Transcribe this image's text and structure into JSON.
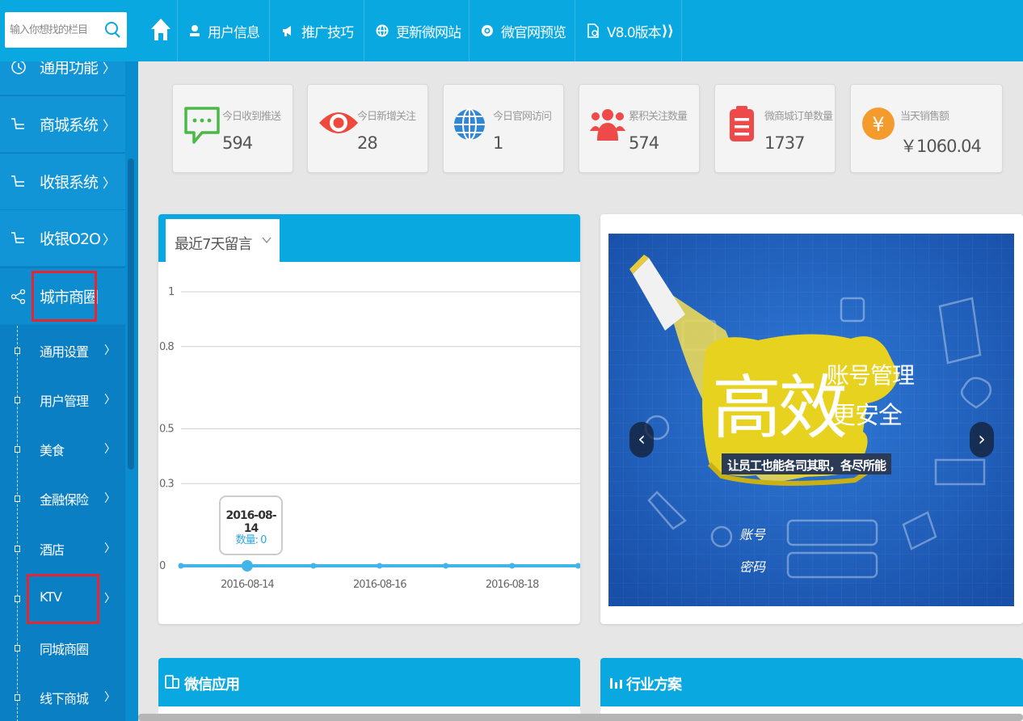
{
  "search": {
    "placeholder": "输入你想找的栏目"
  },
  "top_nav": [
    {
      "label": "用户信息",
      "icon": "user-icon"
    },
    {
      "label": "推广技巧",
      "icon": "megaphone-icon"
    },
    {
      "label": "更新微网站",
      "icon": "globe-icon"
    },
    {
      "label": "微官网预览",
      "icon": "eye-icon"
    },
    {
      "label": "V8.0版本",
      "icon": "version-icon"
    }
  ],
  "sidebar": {
    "main_items": [
      {
        "label": "通用功能",
        "icon": "function-icon"
      },
      {
        "label": "商城系统",
        "icon": "cart-icon"
      },
      {
        "label": "收银系统",
        "icon": "cart-icon"
      },
      {
        "label": "收银O2O",
        "icon": "cart-icon"
      },
      {
        "label": "城市商圈",
        "icon": "share-icon"
      }
    ],
    "sub_items": [
      {
        "label": "通用设置",
        "chevron": "〉"
      },
      {
        "label": "用户管理",
        "chevron": "〉"
      },
      {
        "label": "美食",
        "chevron": "〉"
      },
      {
        "label": "金融保险",
        "chevron": "〉"
      },
      {
        "label": "酒店",
        "chevron": "〉"
      },
      {
        "label": "KTV",
        "chevron": "〉"
      },
      {
        "label": "同城商圈",
        "chevron": ""
      },
      {
        "label": "线下商城",
        "chevron": "〉"
      }
    ],
    "chevron": "〉",
    "highlight_color": "#e8252f"
  },
  "stats": [
    {
      "label": "今日收到推送",
      "value": "594",
      "icon": "message-icon",
      "color": "#4cb848"
    },
    {
      "label": "今日新增关注",
      "value": "28",
      "icon": "eye-icon",
      "color": "#ee4a3c"
    },
    {
      "label": "今日官网访问",
      "value": "1",
      "icon": "globe-icon",
      "color": "#2f87d8"
    },
    {
      "label": "累积关注数量",
      "value": "574",
      "icon": "users-icon",
      "color": "#ee4a4a"
    },
    {
      "label": "微商城订单数量",
      "value": "1737",
      "icon": "clipboard-icon",
      "color": "#ee4a4a"
    },
    {
      "label": "当天销售额",
      "value": "￥1060.04",
      "icon": "yen-icon",
      "color": "#f39c2d"
    }
  ],
  "chart_panel": {
    "select_label": "最近7天留言",
    "tooltip": {
      "date": "2016-08-14",
      "label": "数量: 0"
    }
  },
  "chart_data": {
    "type": "line",
    "title": "",
    "x": [
      "2016-08-13",
      "2016-08-14",
      "2016-08-15",
      "2016-08-16",
      "2016-08-17",
      "2016-08-18",
      "2016-08-19"
    ],
    "x_tick_labels": [
      "2016-08-14",
      "2016-08-16",
      "2016-08-18"
    ],
    "y_ticks": [
      0,
      0.3,
      0.5,
      0.8,
      1
    ],
    "ylim": [
      0,
      1.05
    ],
    "grid": true,
    "series": [
      {
        "values": [
          0,
          0,
          0,
          0,
          0,
          0,
          0
        ],
        "color": "#41b4ea"
      }
    ],
    "highlighted_index": 1
  },
  "banner": {
    "main_text": "高效",
    "side_text_1": "账号管理",
    "side_text_2": "更安全",
    "slogan": "让员工也能各司其职，各尽所能",
    "form_label_1": "账号",
    "form_label_2": "密码",
    "prev": "‹",
    "next": "›"
  },
  "bottom_panels": [
    {
      "title": "微信应用",
      "icon": "mobile-icon"
    },
    {
      "title": "行业方案",
      "icon": "chart-bars-icon"
    }
  ],
  "colors": {
    "topbar": "#0aa8e0",
    "sidebar": "#0b7fc4",
    "sidebar_main": "#1295d6",
    "background": "#e6e6e6"
  }
}
